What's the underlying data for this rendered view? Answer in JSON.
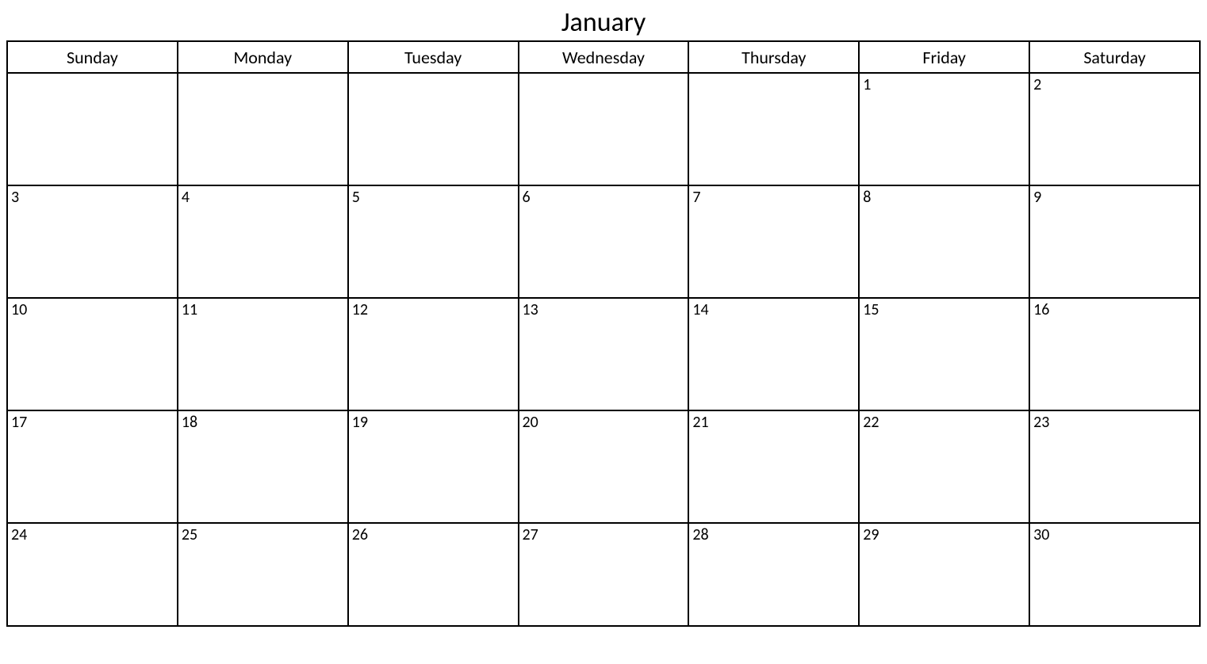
{
  "month_title": "January",
  "days_of_week": [
    "Sunday",
    "Monday",
    "Tuesday",
    "Wednesday",
    "Thursday",
    "Friday",
    "Saturday"
  ],
  "weeks": [
    [
      "",
      "",
      "",
      "",
      "",
      "1",
      "2"
    ],
    [
      "3",
      "4",
      "5",
      "6",
      "7",
      "8",
      "9"
    ],
    [
      "10",
      "11",
      "12",
      "13",
      "14",
      "15",
      "16"
    ],
    [
      "17",
      "18",
      "19",
      "20",
      "21",
      "22",
      "23"
    ],
    [
      "24",
      "25",
      "26",
      "27",
      "28",
      "29",
      "30"
    ]
  ]
}
